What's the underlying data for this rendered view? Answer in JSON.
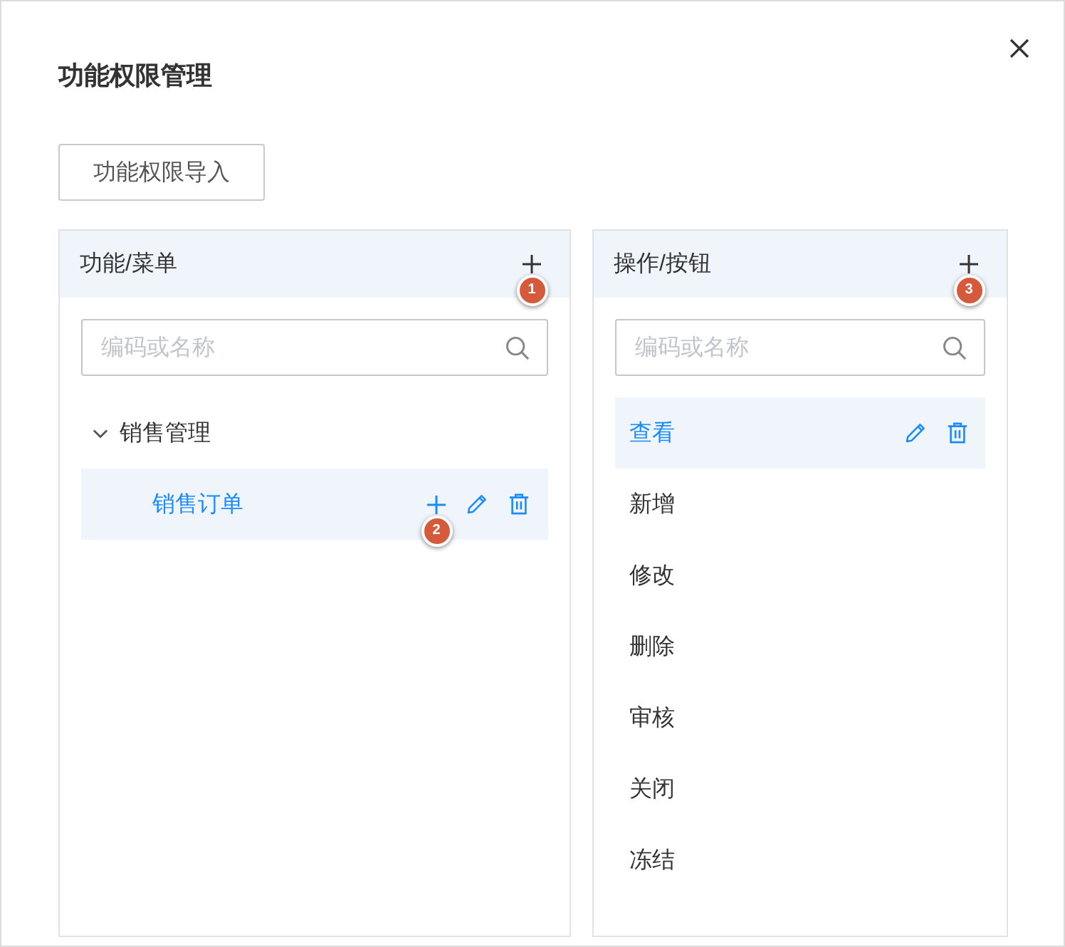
{
  "dialog": {
    "title": "功能权限管理"
  },
  "import_button": "功能权限导入",
  "menu_panel": {
    "title": "功能/菜单",
    "add_badge": "1",
    "search": {
      "placeholder": "编码或名称"
    },
    "tree": [
      {
        "label": "销售管理",
        "expanded": true,
        "children": [
          {
            "label": "销售订单",
            "selected": true,
            "badge": "2"
          }
        ]
      }
    ]
  },
  "action_panel": {
    "title": "操作/按钮",
    "add_badge": "3",
    "search": {
      "placeholder": "编码或名称"
    },
    "items": [
      {
        "label": "查看",
        "selected": true
      },
      {
        "label": "新增",
        "selected": false
      },
      {
        "label": "修改",
        "selected": false
      },
      {
        "label": "删除",
        "selected": false
      },
      {
        "label": "审核",
        "selected": false
      },
      {
        "label": "关闭",
        "selected": false
      },
      {
        "label": "冻结",
        "selected": false
      }
    ]
  }
}
